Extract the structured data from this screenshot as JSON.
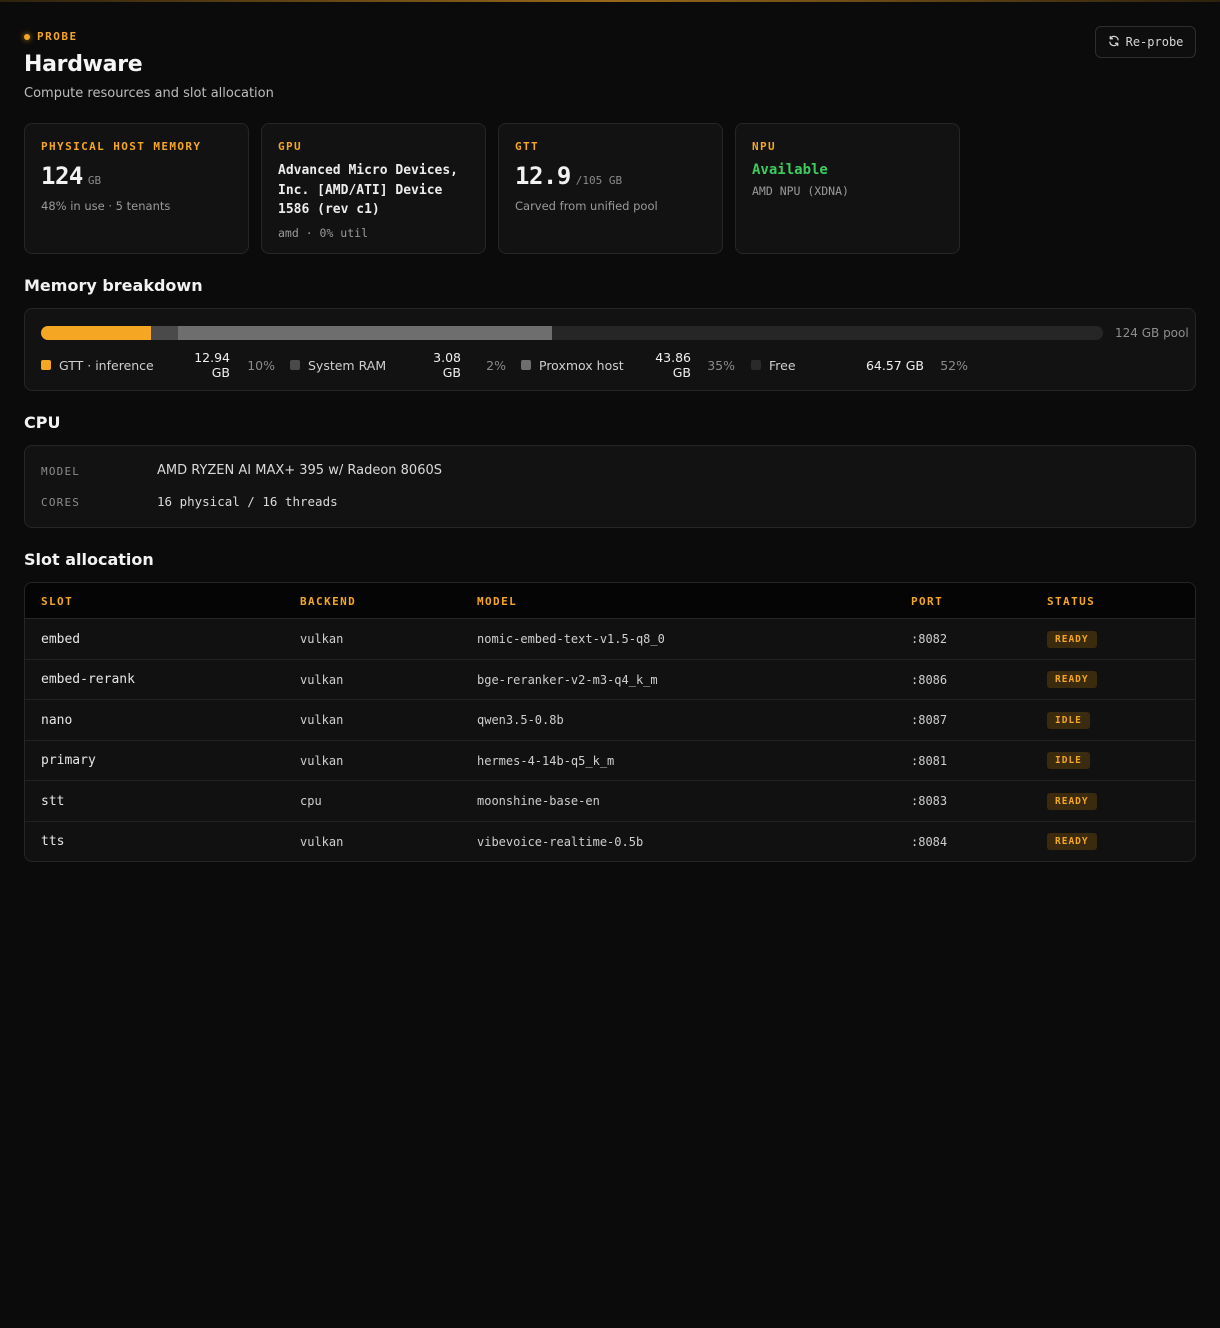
{
  "header": {
    "eyebrow": "PROBE",
    "title": "Hardware",
    "subtitle": "Compute resources and slot allocation",
    "reprobe_label": "Re-probe"
  },
  "cards": {
    "memory": {
      "label": "PHYSICAL HOST MEMORY",
      "value": "124",
      "unit": "GB",
      "note": "48% in use · 5 tenants"
    },
    "gpu": {
      "label": "GPU",
      "name": "Advanced Micro Devices, Inc. [AMD/ATI] Device 1586 (rev c1)",
      "note": "amd · 0% util"
    },
    "gtt": {
      "label": "GTT",
      "value": "12.9",
      "unit": "/105 GB",
      "note": "Carved from unified pool"
    },
    "npu": {
      "label": "NPU",
      "status": "Available",
      "note": "AMD NPU (XDNA)"
    }
  },
  "memory_breakdown": {
    "title": "Memory breakdown",
    "pool_label": "124 GB pool",
    "segments": [
      {
        "name": "GTT · inference",
        "value": "12.94 GB",
        "pct": "10%",
        "fraction": 0.104,
        "color": "#f5a623"
      },
      {
        "name": "System RAM",
        "value": "3.08 GB",
        "pct": "2%",
        "fraction": 0.025,
        "color": "#4a4a4a"
      },
      {
        "name": "Proxmox host",
        "value": "43.86 GB",
        "pct": "35%",
        "fraction": 0.352,
        "color": "#6e6e6e"
      },
      {
        "name": "Free",
        "value": "64.57 GB",
        "pct": "52%",
        "fraction": 0.519,
        "color": "#262626"
      }
    ]
  },
  "cpu": {
    "title": "CPU",
    "model_key": "MODEL",
    "model_value": "AMD RYZEN AI MAX+ 395 w/ Radeon 8060S",
    "cores_key": "CORES",
    "cores_value": "16 physical / 16 threads"
  },
  "slots": {
    "title": "Slot allocation",
    "columns": [
      "SLOT",
      "BACKEND",
      "MODEL",
      "PORT",
      "STATUS"
    ],
    "rows": [
      {
        "slot": "embed",
        "backend": "vulkan",
        "model": "nomic-embed-text-v1.5-q8_0",
        "port": ":8082",
        "status": "READY"
      },
      {
        "slot": "embed-rerank",
        "backend": "vulkan",
        "model": "bge-reranker-v2-m3-q4_k_m",
        "port": ":8086",
        "status": "READY"
      },
      {
        "slot": "nano",
        "backend": "vulkan",
        "model": "qwen3.5-0.8b",
        "port": ":8087",
        "status": "IDLE"
      },
      {
        "slot": "primary",
        "backend": "vulkan",
        "model": "hermes-4-14b-q5_k_m",
        "port": ":8081",
        "status": "IDLE"
      },
      {
        "slot": "stt",
        "backend": "cpu",
        "model": "moonshine-base-en",
        "port": ":8083",
        "status": "READY"
      },
      {
        "slot": "tts",
        "backend": "vulkan",
        "model": "vibevoice-realtime-0.5b",
        "port": ":8084",
        "status": "READY"
      }
    ]
  }
}
